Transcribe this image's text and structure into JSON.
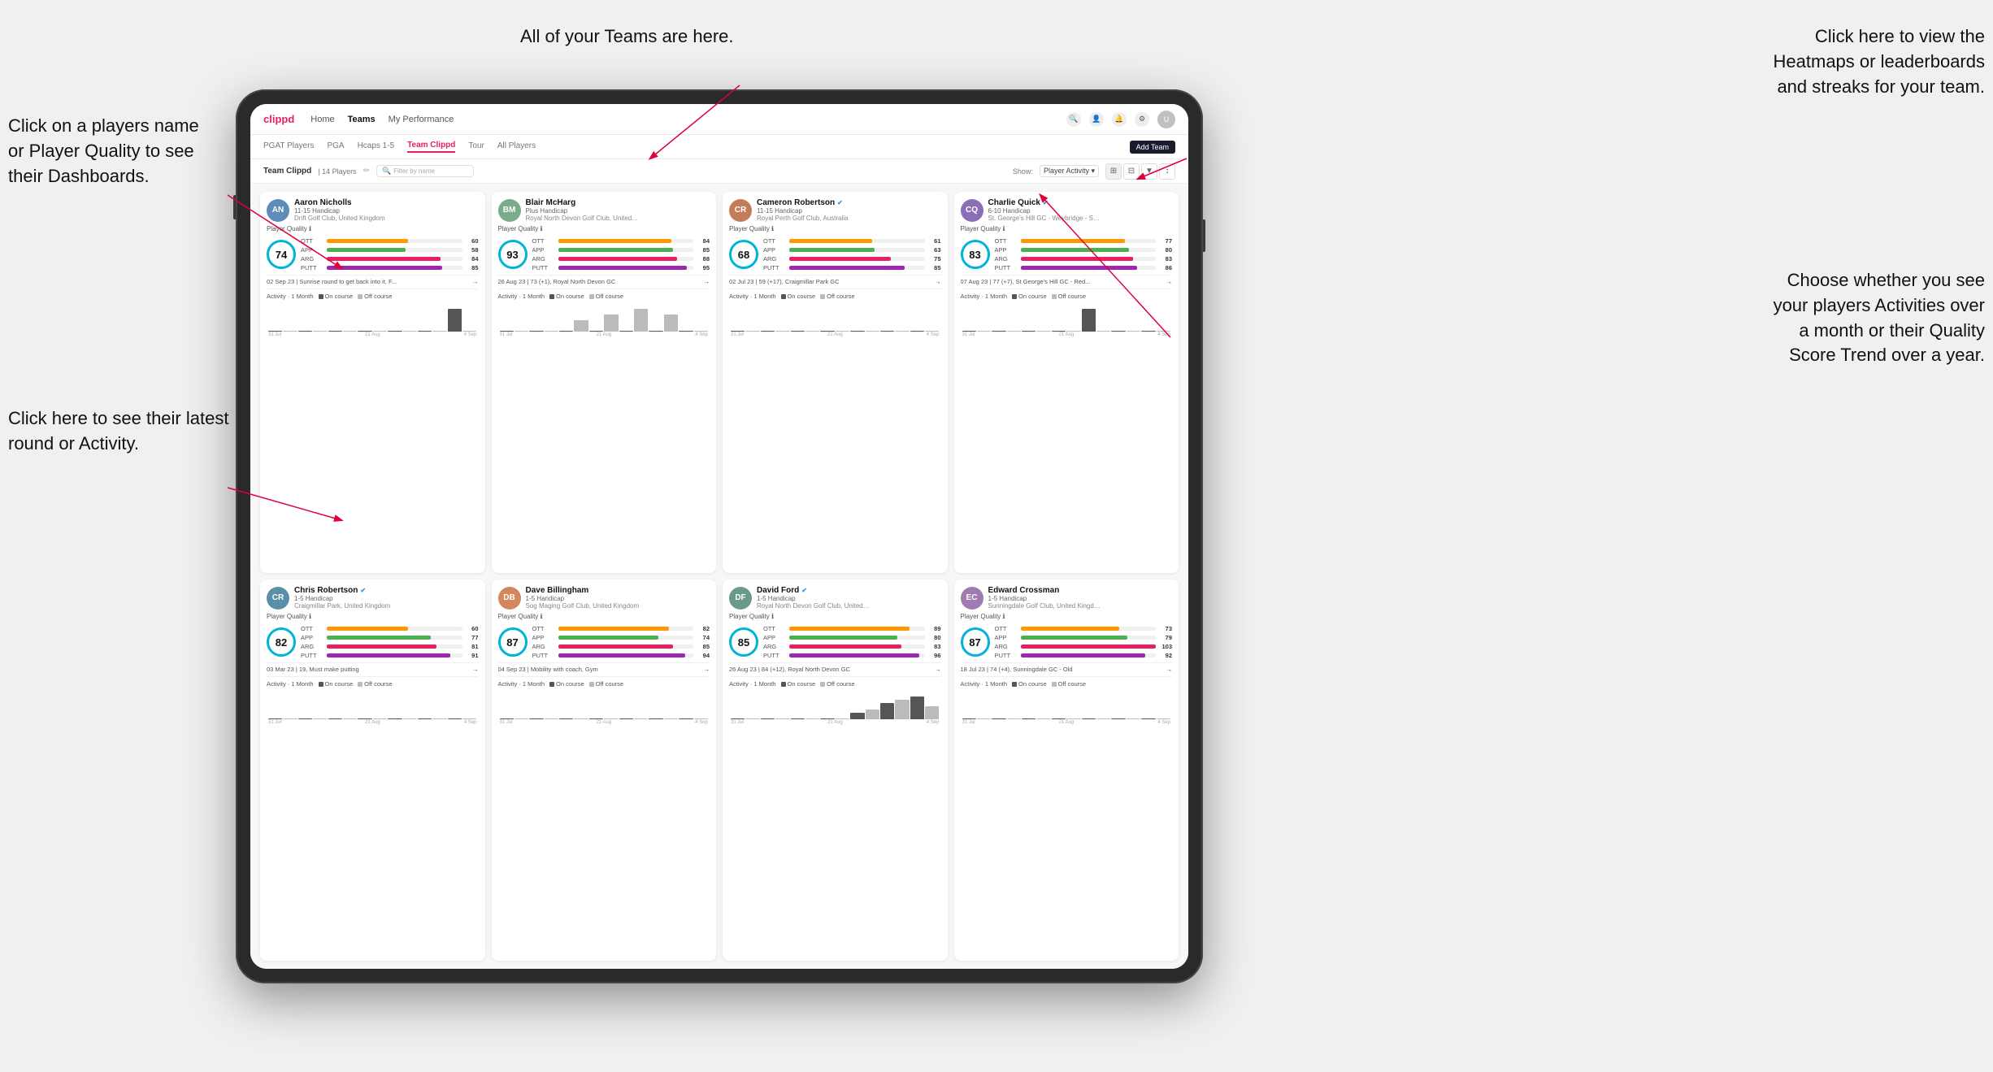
{
  "annotations": {
    "click_player": "Click on a players name\nor Player Quality to see\ntheir Dashboards.",
    "teams_here": "All of your Teams are here.",
    "heatmaps": "Click here to view the\nHeatmaps or leaderboards\nand streaks for your team.",
    "latest_round": "Click here to see their latest\nround or Activity.",
    "activities": "Choose whether you see\nyour players Activities over\na month or their Quality\nScore Trend over a year."
  },
  "navbar": {
    "logo": "clippd",
    "links": [
      "Home",
      "Teams",
      "My Performance"
    ],
    "active_link": "Teams"
  },
  "tabs": {
    "items": [
      "PGAT Players",
      "PGA",
      "Hcaps 1-5",
      "Team Clippd",
      "Tour",
      "All Players"
    ],
    "active": "Team Clippd",
    "add_button": "Add Team"
  },
  "toolbar": {
    "team_label": "Team Clippd",
    "player_count": "| 14 Players",
    "search_placeholder": "Filter by name",
    "show_label": "Show:",
    "show_value": "Player Activity",
    "view_options": [
      "grid-2",
      "grid-3",
      "filter",
      "sort"
    ]
  },
  "players": [
    {
      "name": "Aaron Nicholls",
      "handicap": "11-15 Handicap",
      "club": "Drift Golf Club, United Kingdom",
      "quality": 74,
      "circle_color": "#00b4d8",
      "stats": [
        {
          "label": "OTT",
          "value": 60,
          "pct": 60,
          "color": "#ff9800"
        },
        {
          "label": "APP",
          "value": 58,
          "pct": 58,
          "color": "#4caf50"
        },
        {
          "label": "ARG",
          "value": 84,
          "pct": 84,
          "color": "#e91e63"
        },
        {
          "label": "PUTT",
          "value": 85,
          "pct": 85,
          "color": "#9c27b0"
        }
      ],
      "latest": "02 Sep 23 | Sunrise round to get back into it, F...",
      "chart_bars": [
        0,
        0,
        0,
        0,
        0,
        0,
        0,
        0,
        0,
        0,
        0,
        0,
        1,
        0
      ],
      "dates": [
        "31 Jul",
        "21 Aug",
        "4 Sep"
      ],
      "verified": false
    },
    {
      "name": "Blair McHarg",
      "handicap": "Plus Handicap",
      "club": "Royal North Devon Golf Club, United Kin...",
      "quality": 93,
      "circle_color": "#00b4d8",
      "stats": [
        {
          "label": "OTT",
          "value": 84,
          "pct": 84,
          "color": "#ff9800"
        },
        {
          "label": "APP",
          "value": 85,
          "pct": 85,
          "color": "#4caf50"
        },
        {
          "label": "ARG",
          "value": 88,
          "pct": 88,
          "color": "#e91e63"
        },
        {
          "label": "PUTT",
          "value": 95,
          "pct": 95,
          "color": "#9c27b0"
        }
      ],
      "latest": "26 Aug 23 | 73 (+1), Royal North Devon GC",
      "chart_bars": [
        0,
        0,
        0,
        0,
        0,
        2,
        0,
        3,
        0,
        4,
        0,
        3,
        0,
        0
      ],
      "dates": [
        "31 Jul",
        "21 Aug",
        "4 Sep"
      ],
      "verified": false
    },
    {
      "name": "Cameron Robertson",
      "handicap": "11-15 Handicap",
      "club": "Royal Perth Golf Club, Australia",
      "quality": 68,
      "circle_color": "#00b4d8",
      "stats": [
        {
          "label": "OTT",
          "value": 61,
          "pct": 61,
          "color": "#ff9800"
        },
        {
          "label": "APP",
          "value": 63,
          "pct": 63,
          "color": "#4caf50"
        },
        {
          "label": "ARG",
          "value": 75,
          "pct": 75,
          "color": "#e91e63"
        },
        {
          "label": "PUTT",
          "value": 85,
          "pct": 85,
          "color": "#9c27b0"
        }
      ],
      "latest": "02 Jul 23 | 59 (+17), Craigmillar Park GC",
      "chart_bars": [
        0,
        0,
        0,
        0,
        0,
        0,
        0,
        0,
        0,
        0,
        0,
        0,
        0,
        0
      ],
      "dates": [
        "31 Jul",
        "21 Aug",
        "4 Sep"
      ],
      "verified": true
    },
    {
      "name": "Charlie Quick",
      "handicap": "6-10 Handicap",
      "club": "St. George's Hill GC - Weybridge - Surrey...",
      "quality": 83,
      "circle_color": "#00b4d8",
      "stats": [
        {
          "label": "OTT",
          "value": 77,
          "pct": 77,
          "color": "#ff9800"
        },
        {
          "label": "APP",
          "value": 80,
          "pct": 80,
          "color": "#4caf50"
        },
        {
          "label": "ARG",
          "value": 83,
          "pct": 83,
          "color": "#e91e63"
        },
        {
          "label": "PUTT",
          "value": 86,
          "pct": 86,
          "color": "#9c27b0"
        }
      ],
      "latest": "07 Aug 23 | 77 (+7), St George's Hill GC - Red...",
      "chart_bars": [
        0,
        0,
        0,
        0,
        0,
        0,
        0,
        0,
        2,
        0,
        0,
        0,
        0,
        0
      ],
      "dates": [
        "31 Jul",
        "21 Aug",
        "4 Sep"
      ],
      "verified": true
    },
    {
      "name": "Chris Robertson",
      "handicap": "1-5 Handicap",
      "club": "Craigmillar Park, United Kingdom",
      "quality": 82,
      "circle_color": "#00b4d8",
      "stats": [
        {
          "label": "OTT",
          "value": 60,
          "pct": 60,
          "color": "#ff9800"
        },
        {
          "label": "APP",
          "value": 77,
          "pct": 77,
          "color": "#4caf50"
        },
        {
          "label": "ARG",
          "value": 81,
          "pct": 81,
          "color": "#e91e63"
        },
        {
          "label": "PUTT",
          "value": 91,
          "pct": 91,
          "color": "#9c27b0"
        }
      ],
      "latest": "03 Mar 23 | 19, Must make putting",
      "chart_bars": [
        0,
        0,
        0,
        0,
        0,
        0,
        0,
        0,
        0,
        0,
        0,
        0,
        0,
        0
      ],
      "dates": [
        "31 Jul",
        "21 Aug",
        "4 Sep"
      ],
      "verified": true
    },
    {
      "name": "Dave Billingham",
      "handicap": "1-5 Handicap",
      "club": "Sog Maging Golf Club, United Kingdom",
      "quality": 87,
      "circle_color": "#00b4d8",
      "stats": [
        {
          "label": "OTT",
          "value": 82,
          "pct": 82,
          "color": "#ff9800"
        },
        {
          "label": "APP",
          "value": 74,
          "pct": 74,
          "color": "#4caf50"
        },
        {
          "label": "ARG",
          "value": 85,
          "pct": 85,
          "color": "#e91e63"
        },
        {
          "label": "PUTT",
          "value": 94,
          "pct": 94,
          "color": "#9c27b0"
        }
      ],
      "latest": "04 Sep 23 | Mobility with coach, Gym",
      "chart_bars": [
        0,
        0,
        0,
        0,
        0,
        0,
        0,
        0,
        0,
        0,
        0,
        0,
        0,
        0
      ],
      "dates": [
        "31 Jul",
        "21 Aug",
        "4 Sep"
      ],
      "verified": false
    },
    {
      "name": "David Ford",
      "handicap": "1-5 Handicap",
      "club": "Royal North Devon Golf Club, United Kil...",
      "quality": 85,
      "circle_color": "#00b4d8",
      "stats": [
        {
          "label": "OTT",
          "value": 89,
          "pct": 89,
          "color": "#ff9800"
        },
        {
          "label": "APP",
          "value": 80,
          "pct": 80,
          "color": "#4caf50"
        },
        {
          "label": "ARG",
          "value": 83,
          "pct": 83,
          "color": "#e91e63"
        },
        {
          "label": "PUTT",
          "value": 96,
          "pct": 96,
          "color": "#9c27b0"
        }
      ],
      "latest": "26 Aug 23 | 84 (+12), Royal North Devon GC",
      "chart_bars": [
        0,
        0,
        0,
        0,
        0,
        0,
        0,
        0,
        2,
        3,
        5,
        6,
        7,
        4
      ],
      "dates": [
        "31 Jul",
        "21 Aug",
        "4 Sep"
      ],
      "verified": true
    },
    {
      "name": "Edward Crossman",
      "handicap": "1-5 Handicap",
      "club": "Sunningdale Golf Club, United Kingdom",
      "quality": 87,
      "circle_color": "#00b4d8",
      "stats": [
        {
          "label": "OTT",
          "value": 73,
          "pct": 73,
          "color": "#ff9800"
        },
        {
          "label": "APP",
          "value": 79,
          "pct": 79,
          "color": "#4caf50"
        },
        {
          "label": "ARG",
          "value": 103,
          "pct": 100,
          "color": "#e91e63"
        },
        {
          "label": "PUTT",
          "value": 92,
          "pct": 92,
          "color": "#9c27b0"
        }
      ],
      "latest": "18 Jul 23 | 74 (+4), Sunningdale GC - Old",
      "chart_bars": [
        0,
        0,
        0,
        0,
        0,
        0,
        0,
        0,
        0,
        0,
        0,
        0,
        0,
        0
      ],
      "dates": [
        "31 Jul",
        "21 Aug",
        "4 Sep"
      ],
      "verified": false
    }
  ],
  "activity": {
    "label": "Activity · 1 Month",
    "on_course": "On course",
    "off_course": "Off course",
    "on_color": "#555555",
    "off_color": "#bbbbbb"
  }
}
